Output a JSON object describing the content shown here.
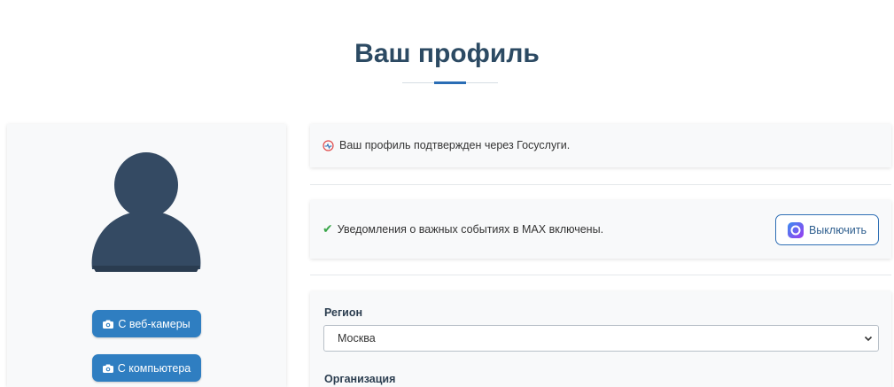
{
  "page": {
    "title": "Ваш профиль"
  },
  "photo": {
    "webcam_label": "С веб-камеры",
    "computer_label": "С компьютера"
  },
  "gosuslugi": {
    "text": "Ваш профиль подтвержден через Госуслуги."
  },
  "notifications": {
    "text": "Уведомления о важных событиях в MAX включены.",
    "button_label": "Выключить"
  },
  "form": {
    "region_label": "Регион",
    "region_value": "Москва",
    "organization_label": "Организация"
  },
  "colors": {
    "title": "#2c4a63",
    "accent": "#2a6db5",
    "primary_button": "#2f7ec1",
    "avatar": "#344a63",
    "success": "#3aa64a"
  },
  "icons": {
    "camera": "camera-icon",
    "gosuslugi": "gosuslugi-icon",
    "check": "check-icon",
    "max_logo": "max-logo-icon",
    "chevron": "chevron-down-icon",
    "avatar": "user-avatar-icon"
  }
}
